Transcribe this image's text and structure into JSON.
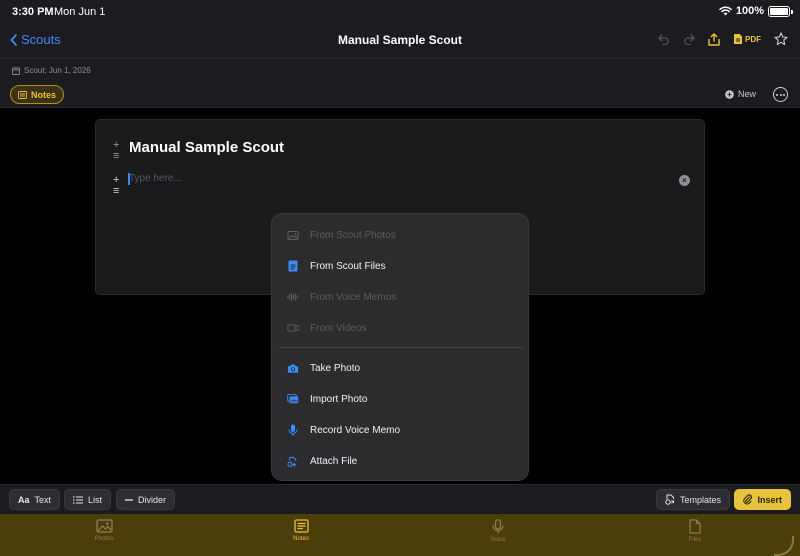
{
  "status_bar": {
    "time": "3:30 PM",
    "date": "Mon Jun 1",
    "battery": "100%"
  },
  "nav": {
    "back_label": "Scouts",
    "title": "Manual Sample Scout",
    "pdf_label": "PDF"
  },
  "meta": {
    "scout_date": "Scout: Jun 1, 2026"
  },
  "tabs": {
    "notes_label": "Notes",
    "new_label": "New"
  },
  "document": {
    "title": "Manual Sample Scout",
    "body_placeholder": "Type here..."
  },
  "insert_menu": {
    "items": [
      {
        "label": "From Scout Photos",
        "icon": "photo-icon",
        "enabled": false
      },
      {
        "label": "From Scout Files",
        "icon": "file-icon",
        "enabled": true
      },
      {
        "label": "From Voice Memos",
        "icon": "waveform-icon",
        "enabled": false
      },
      {
        "label": "From Videos",
        "icon": "video-icon",
        "enabled": false
      },
      {
        "label": "Take Photo",
        "icon": "camera-icon",
        "enabled": true
      },
      {
        "label": "Import Photo",
        "icon": "photo-stack-icon",
        "enabled": true
      },
      {
        "label": "Record Voice Memo",
        "icon": "microphone-icon",
        "enabled": true
      },
      {
        "label": "Attach File",
        "icon": "attach-file-icon",
        "enabled": true
      }
    ]
  },
  "toolbar": {
    "text_icon": "Aa",
    "text_label": "Text",
    "list_label": "List",
    "divider_label": "Divider",
    "templates_label": "Templates",
    "insert_label": "Insert"
  },
  "bottom_tabs": [
    {
      "label": "Photos",
      "icon": "photo-icon",
      "active": false
    },
    {
      "label": "Notes",
      "icon": "notes-icon",
      "active": true
    },
    {
      "label": "Voice",
      "icon": "microphone-icon",
      "active": false
    },
    {
      "label": "Files",
      "icon": "file-icon",
      "active": false
    }
  ],
  "colors": {
    "accent": "#e7c23d",
    "link": "#3a8ef6",
    "menu_icon": "#3a8ef6",
    "background": "#000000"
  }
}
